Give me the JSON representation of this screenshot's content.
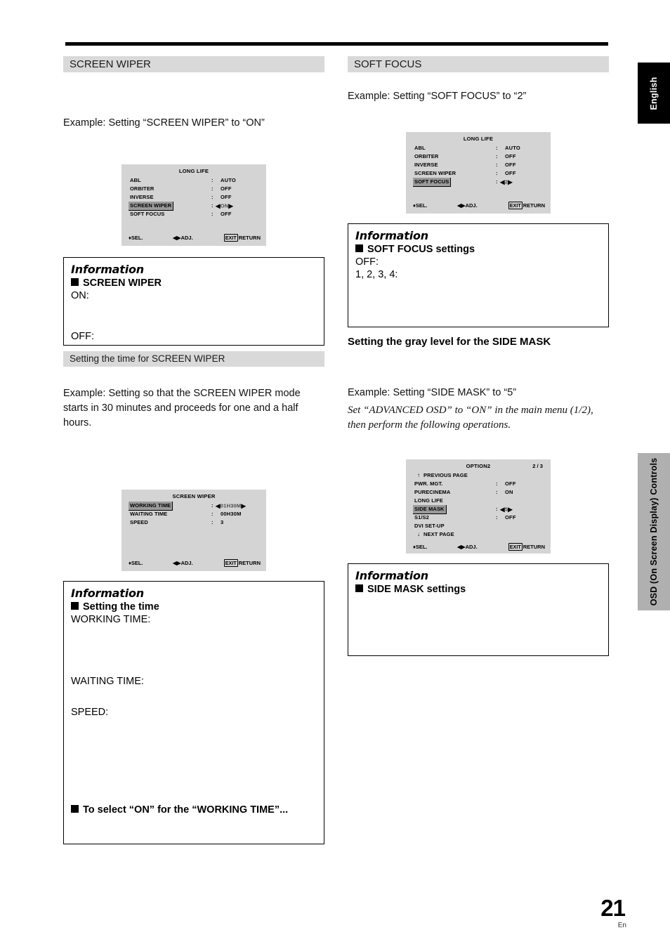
{
  "page": {
    "language_tab": "English",
    "side_tab": "OSD (On Screen Display) Controls",
    "number": "21",
    "number_suffix": "En"
  },
  "left_column": {
    "section_header": "SCREEN WIPER",
    "example_line": "Example: Setting “SCREEN WIPER” to “ON”",
    "osd_long_life": {
      "title": "LONG LIFE",
      "rows": [
        {
          "label": "ABL",
          "colon": ":",
          "value": "AUTO",
          "selected": false,
          "adjust": false
        },
        {
          "label": "ORBITER",
          "colon": ":",
          "value": "OFF",
          "selected": false,
          "adjust": false
        },
        {
          "label": "INVERSE",
          "colon": ":",
          "value": "OFF",
          "selected": false,
          "adjust": false
        },
        {
          "label": "SCREEN WIPER",
          "colon": ":",
          "value": "ON",
          "selected": true,
          "adjust": true
        },
        {
          "label": "SOFT FOCUS",
          "colon": ":",
          "value": "OFF",
          "selected": false,
          "adjust": false
        }
      ],
      "footer": {
        "sel": "SEL.",
        "adj": "ADJ.",
        "exit": "EXIT",
        "return": "RETURN"
      }
    },
    "info_screen_wiper": {
      "title": "Information",
      "heading": "SCREEN WIPER",
      "term_on": "ON:",
      "term_off": "OFF:"
    },
    "subsection_header": "Setting the time for SCREEN WIPER",
    "example_paragraph": "Example: Setting so that the SCREEN WIPER mode starts in 30 minutes and proceeds for one and a half hours.",
    "osd_screen_wiper": {
      "title": "SCREEN WIPER",
      "rows": [
        {
          "label": "WORKING TIME",
          "colon": ":",
          "value": "01H30M",
          "selected": true,
          "adjust": true
        },
        {
          "label": "WAITING TIME",
          "colon": ":",
          "value": "00H30M",
          "selected": false,
          "adjust": false
        },
        {
          "label": "SPEED",
          "colon": ":",
          "value": "3",
          "selected": false,
          "adjust": false
        }
      ],
      "footer": {
        "sel": "SEL.",
        "adj": "ADJ.",
        "exit": "EXIT",
        "return": "RETURN"
      }
    },
    "info_setting_time": {
      "title": "Information",
      "heading": "Setting the time",
      "term_working": "WORKING TIME:",
      "term_waiting": "WAITING  TIME:",
      "term_speed": "SPEED:",
      "note_heading": "To select “ON” for the “WORKING TIME”..."
    }
  },
  "right_column": {
    "section_header": "SOFT FOCUS",
    "example_line": "Example: Setting “SOFT FOCUS” to “2”",
    "osd_long_life": {
      "title": "LONG LIFE",
      "rows": [
        {
          "label": "ABL",
          "colon": ":",
          "value": "AUTO",
          "selected": false,
          "adjust": false
        },
        {
          "label": "ORBITER",
          "colon": ":",
          "value": "OFF",
          "selected": false,
          "adjust": false
        },
        {
          "label": "INVERSE",
          "colon": ":",
          "value": "OFF",
          "selected": false,
          "adjust": false
        },
        {
          "label": "SCREEN WIPER",
          "colon": ":",
          "value": "OFF",
          "selected": false,
          "adjust": false
        },
        {
          "label": "SOFT FOCUS",
          "colon": ":",
          "value": "2",
          "selected": true,
          "adjust": true
        }
      ],
      "footer": {
        "sel": "SEL.",
        "adj": "ADJ.",
        "exit": "EXIT",
        "return": "RETURN"
      }
    },
    "info_soft_focus": {
      "title": "Information",
      "heading": "SOFT FOCUS settings",
      "term_off": "OFF:",
      "term_levels": "1, 2, 3, 4:"
    },
    "subsection_header": "Setting the gray level for the SIDE MASK",
    "example_line2": "Example: Setting “SIDE MASK” to “5”",
    "example_italic": "Set “ADVANCED OSD” to “ON” in the main menu (1/2), then perform the following operations.",
    "osd_option2": {
      "title": "OPTION2",
      "page_indicator": "2 / 3",
      "prev_page": "PREVIOUS PAGE",
      "next_page": "NEXT PAGE",
      "rows": [
        {
          "label": "PWR. MGT.",
          "colon": ":",
          "value": "OFF",
          "selected": false,
          "adjust": false
        },
        {
          "label": "PURECINEMA",
          "colon": ":",
          "value": "ON",
          "selected": false,
          "adjust": false
        },
        {
          "label": "LONG LIFE",
          "colon": "",
          "value": "",
          "selected": false,
          "adjust": false
        },
        {
          "label": "SIDE MASK",
          "colon": ":",
          "value": "5",
          "selected": true,
          "adjust": true
        },
        {
          "label": "S1/S2",
          "colon": ":",
          "value": "OFF",
          "selected": false,
          "adjust": false
        },
        {
          "label": "DVI SET-UP",
          "colon": "",
          "value": "",
          "selected": false,
          "adjust": false
        }
      ],
      "footer": {
        "sel": "SEL.",
        "adj": "ADJ.",
        "exit": "EXIT",
        "return": "RETURN"
      }
    },
    "info_side_mask": {
      "title": "Information",
      "heading": "SIDE MASK settings"
    }
  },
  "icons": {
    "left_arrow": "◀",
    "right_arrow": "▶",
    "up_down": "♦",
    "up_arrow": "↑",
    "down_arrow": "↓"
  }
}
